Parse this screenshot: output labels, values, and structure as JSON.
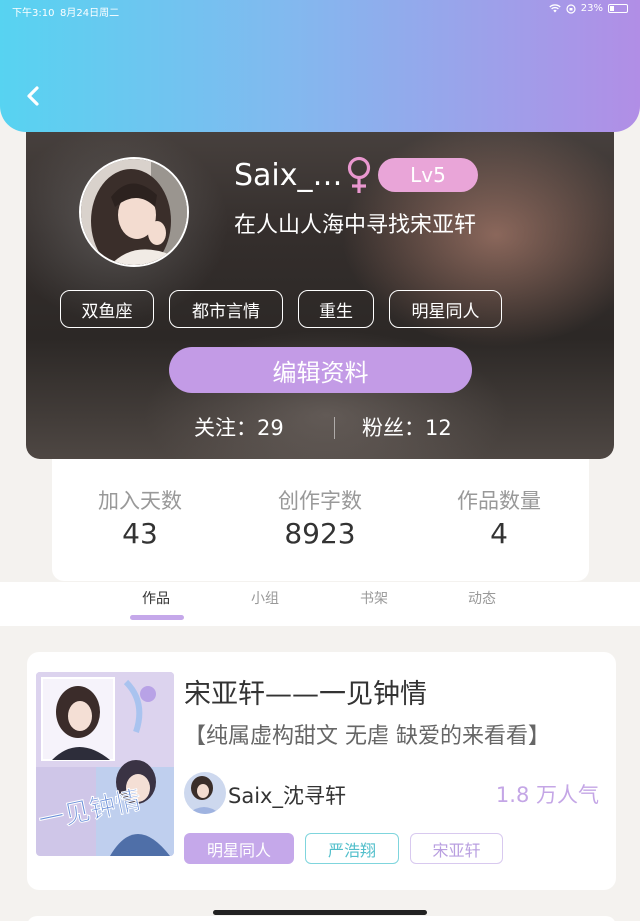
{
  "status_bar": {
    "time": "下午3:10",
    "date": "8月24日周二",
    "battery": "23%"
  },
  "profile": {
    "username": "Saix_…",
    "level": "Lv5",
    "signature": "在人山人海中寻找宋亚轩",
    "tags": [
      "双鱼座",
      "都市言情",
      "重生",
      "明星同人"
    ],
    "edit_button": "编辑资料",
    "following": "关注：29",
    "fans": "粉丝：12"
  },
  "stats": [
    {
      "label": "加入天数",
      "value": "43"
    },
    {
      "label": "创作字数",
      "value": "8923"
    },
    {
      "label": "作品数量",
      "value": "4"
    }
  ],
  "tabs": [
    {
      "label": "作品",
      "active": true
    },
    {
      "label": "小组",
      "active": false
    },
    {
      "label": "书架",
      "active": false
    },
    {
      "label": "动态",
      "active": false
    }
  ],
  "work": {
    "title": "宋亚轩——一见钟情",
    "description": "【纯属虚构甜文 无虐 缺爱的来看看】",
    "author": "Saix_沈寻轩",
    "popularity": "1.8 万人气",
    "cover_text": "一见钟情",
    "tags": [
      {
        "label": "明星同人",
        "style": "filled"
      },
      {
        "label": "严浩翔",
        "style": "outline-cyan"
      },
      {
        "label": "宋亚轩",
        "style": "outline-purple"
      }
    ]
  },
  "colors": {
    "accent": "#c39be6",
    "level_badge": "#e9a5d8",
    "header_start": "#57d3f1",
    "header_end": "#b18ee6"
  }
}
